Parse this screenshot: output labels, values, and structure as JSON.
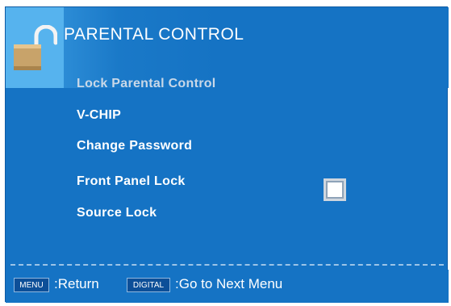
{
  "title": "PARENTAL  CONTROL",
  "menu": {
    "items": [
      "Lock Parental Control",
      "V-CHIP",
      "Change  Password",
      "Front  Panel  Lock",
      "Source  Lock"
    ]
  },
  "footer": {
    "menu_key": "MENU",
    "menu_action": ":Return",
    "digital_key": "DIGITAL",
    "digital_action": ":Go to Next Menu"
  },
  "colors": {
    "panel_bg": "#1573c4",
    "icon_box": "#56b3ee",
    "text": "#ffffff",
    "disabled_text": "#c9d8e8"
  },
  "icons": {
    "lock": "unlocked-padlock-icon"
  },
  "front_panel_lock_checked": false
}
